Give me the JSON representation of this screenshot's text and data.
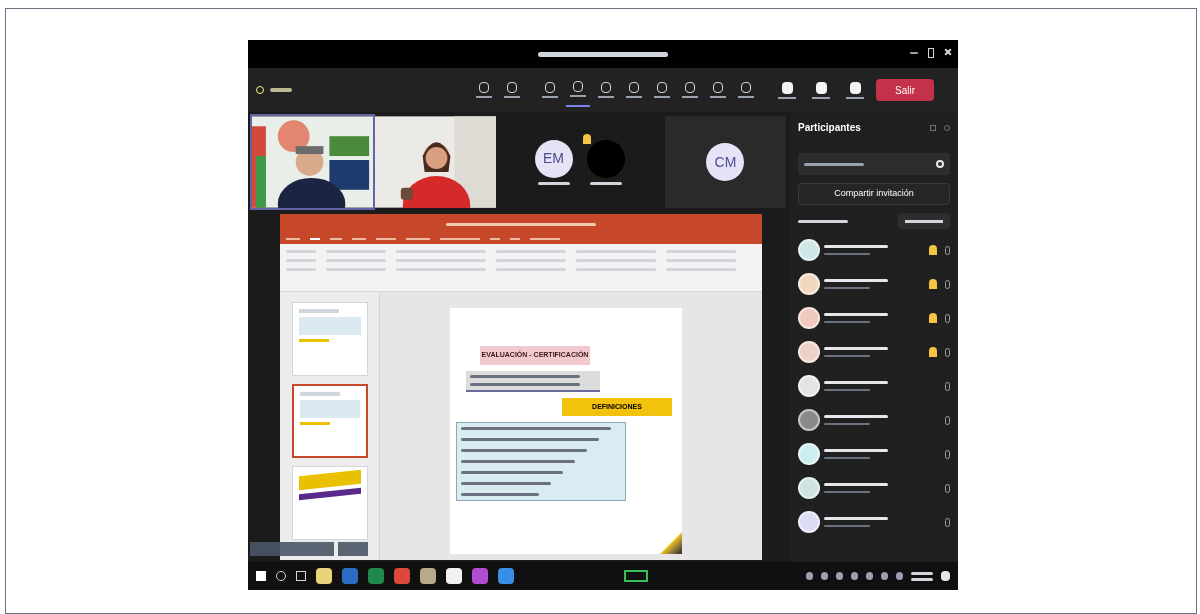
{
  "meeting": {
    "leave_button": {
      "label": "Salir"
    },
    "tools": [
      {
        "selected": false
      },
      {
        "selected": false
      },
      {
        "selected": false
      },
      {
        "selected": true
      },
      {
        "selected": false
      },
      {
        "selected": false
      },
      {
        "selected": false
      },
      {
        "selected": false
      },
      {
        "selected": false
      },
      {
        "selected": false
      }
    ],
    "device_tools": [
      {
        "selected": false
      },
      {
        "selected": false
      },
      {
        "selected": false
      }
    ]
  },
  "video_tiles": [
    {
      "kind": "picture"
    },
    {
      "kind": "picture"
    },
    {
      "kind": "avatars",
      "avatars": [
        {
          "initials": "EM",
          "hand_raised": false
        },
        {
          "hand_raised": true
        }
      ]
    },
    {
      "kind": "avatars",
      "avatars": [
        {
          "initials": "CM",
          "hand_raised": false
        }
      ]
    }
  ],
  "presentation": {
    "thumbnails": [
      {
        "selected": false
      },
      {
        "selected": true
      },
      {
        "selected": false
      }
    ],
    "slide": {
      "title": "EVALUACIÓN - CERTIFICACIÓN",
      "banner": "DEFINICIONES"
    },
    "ribbon_tabs": [
      {
        "selected": false
      },
      {
        "selected": true
      },
      {
        "selected": false
      },
      {
        "selected": false
      },
      {
        "selected": false
      },
      {
        "selected": false
      },
      {
        "selected": false
      },
      {
        "selected": false
      },
      {
        "selected": false
      },
      {
        "selected": false
      }
    ]
  },
  "participants_panel": {
    "title": "Participantes",
    "share_button": "Compartir invitación",
    "participants": [
      {
        "color": "#cfe6e6",
        "hand_raised": true
      },
      {
        "color": "#f1d7c0",
        "hand_raised": true
      },
      {
        "color": "#f0c9c0",
        "hand_raised": true
      },
      {
        "color": "#efd0c8",
        "hand_raised": true
      },
      {
        "color": "#e4e4e4",
        "hand_raised": false
      },
      {
        "color": "#8a8a8a",
        "hand_raised": false
      },
      {
        "color": "#cdeef0",
        "hand_raised": false
      },
      {
        "color": "#cfe3e3",
        "hand_raised": false
      },
      {
        "color": "#dcdcf4",
        "hand_raised": false
      }
    ]
  },
  "taskbar": {
    "apps": [
      {
        "color": "#e8d27a"
      },
      {
        "color": "#2b6cc4"
      },
      {
        "color": "#1f8a4c"
      },
      {
        "color": "#d9483b"
      },
      {
        "color": "#b7a98a"
      },
      {
        "color": "#f2f2f2"
      },
      {
        "color": "#b24ad6"
      },
      {
        "color": "#3a8ee6"
      }
    ]
  }
}
